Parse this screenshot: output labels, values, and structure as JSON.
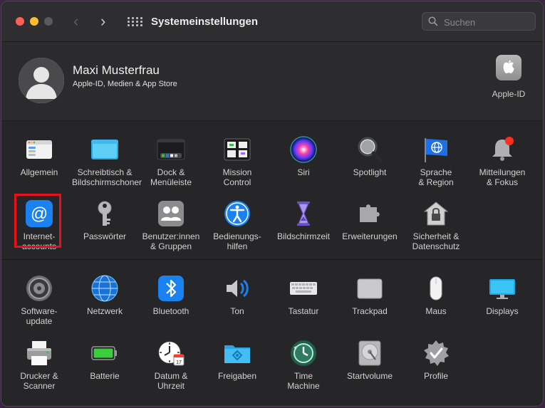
{
  "window": {
    "title": "Systemeinstellungen"
  },
  "search": {
    "placeholder": "Suchen"
  },
  "account": {
    "name": "Maxi Musterfrau",
    "subtitle": "Apple-ID, Medien & App Store",
    "appleid_label": "Apple-ID"
  },
  "section1": [
    {
      "label": "Allgemein",
      "icon": "general-icon"
    },
    {
      "label": "Schreibtisch &\nBildschirmschoner",
      "icon": "desktop-icon"
    },
    {
      "label": "Dock &\nMenüleiste",
      "icon": "dock-icon"
    },
    {
      "label": "Mission\nControl",
      "icon": "mission-control-icon"
    },
    {
      "label": "Siri",
      "icon": "siri-icon"
    },
    {
      "label": "Spotlight",
      "icon": "spotlight-icon"
    },
    {
      "label": "Sprache\n& Region",
      "icon": "language-flag-icon"
    },
    {
      "label": "Mitteilungen\n& Fokus",
      "icon": "notification-bell-icon"
    },
    {
      "label": "Internet-\naccounts",
      "icon": "at-icon"
    },
    {
      "label": "Passwörter",
      "icon": "key-icon"
    },
    {
      "label": "Benutzer:innen\n& Gruppen",
      "icon": "users-icon"
    },
    {
      "label": "Bedienungs-\nhilfen",
      "icon": "accessibility-icon"
    },
    {
      "label": "Bildschirmzeit",
      "icon": "hourglass-icon"
    },
    {
      "label": "Erweiterungen",
      "icon": "puzzle-icon"
    },
    {
      "label": "Sicherheit &\nDatenschutz",
      "icon": "house-lock-icon"
    }
  ],
  "section2": [
    {
      "label": "Software-\nupdate",
      "icon": "gear-icon"
    },
    {
      "label": "Netzwerk",
      "icon": "globe-icon"
    },
    {
      "label": "Bluetooth",
      "icon": "bluetooth-icon"
    },
    {
      "label": "Ton",
      "icon": "speaker-icon"
    },
    {
      "label": "Tastatur",
      "icon": "keyboard-icon"
    },
    {
      "label": "Trackpad",
      "icon": "trackpad-icon"
    },
    {
      "label": "Maus",
      "icon": "mouse-icon"
    },
    {
      "label": "Displays",
      "icon": "display-icon"
    },
    {
      "label": "Drucker &\nScanner",
      "icon": "printer-icon"
    },
    {
      "label": "Batterie",
      "icon": "battery-icon"
    },
    {
      "label": "Datum &\nUhrzeit",
      "icon": "clock-calendar-icon"
    },
    {
      "label": "Freigaben",
      "icon": "folder-share-icon"
    },
    {
      "label": "Time\nMachine",
      "icon": "time-machine-icon"
    },
    {
      "label": "Startvolume",
      "icon": "disk-icon"
    },
    {
      "label": "Profile",
      "icon": "profile-badge-icon"
    }
  ],
  "colors": {
    "highlight": "#e8101a",
    "accent": "#1a82f0"
  }
}
